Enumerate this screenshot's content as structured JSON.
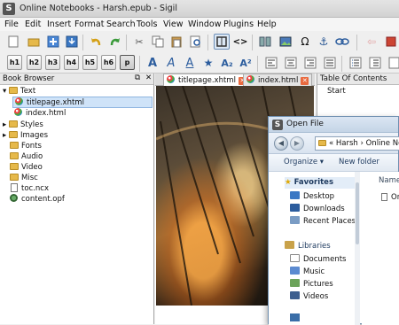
{
  "window": {
    "title": "Online Notebooks - Harsh.epub - Sigil"
  },
  "menu": [
    "File",
    "Edit",
    "Insert",
    "Format",
    "Search",
    "Tools",
    "View",
    "Window",
    "Plugins",
    "Help"
  ],
  "headings": [
    "h1",
    "h2",
    "h3",
    "h4",
    "h5",
    "h6",
    "p"
  ],
  "book_browser": {
    "title": "Book Browser",
    "items": [
      {
        "label": "Text",
        "type": "folder",
        "level": 0,
        "expanded": true
      },
      {
        "label": "titlepage.xhtml",
        "type": "html",
        "level": 1,
        "selected": true
      },
      {
        "label": "index.html",
        "type": "html",
        "level": 1
      },
      {
        "label": "Styles",
        "type": "folder",
        "level": 0
      },
      {
        "label": "Images",
        "type": "folder",
        "level": 0
      },
      {
        "label": "Fonts",
        "type": "folder",
        "level": 0
      },
      {
        "label": "Audio",
        "type": "folder",
        "level": 0
      },
      {
        "label": "Video",
        "type": "folder",
        "level": 0
      },
      {
        "label": "Misc",
        "type": "folder",
        "level": 0
      },
      {
        "label": "toc.ncx",
        "type": "file",
        "level": 0
      },
      {
        "label": "content.opf",
        "type": "file",
        "level": 0
      }
    ]
  },
  "tabs": [
    {
      "label": "titlepage.xhtml",
      "active": true
    },
    {
      "label": "index.html",
      "active": false
    }
  ],
  "toc": {
    "title": "Table Of Contents",
    "items": [
      "Start"
    ]
  },
  "dialog": {
    "title": "Open File",
    "breadcrumb": "« Harsh › Online Notebooks",
    "organize": "Organize ▾",
    "new_folder": "New folder",
    "column": "Name",
    "first_file": "Or",
    "nav": [
      {
        "label": "Favorites",
        "kind": "header",
        "icon": "star-icon"
      },
      {
        "label": "Desktop",
        "kind": "item",
        "icon": "desktop-icon"
      },
      {
        "label": "Downloads",
        "kind": "item",
        "icon": "downloads-icon"
      },
      {
        "label": "Recent Places",
        "kind": "item",
        "icon": "recent-places-icon"
      },
      {
        "label": "Libraries",
        "kind": "header",
        "icon": "libraries-icon"
      },
      {
        "label": "Documents",
        "kind": "item",
        "icon": "documents-icon"
      },
      {
        "label": "Music",
        "kind": "item",
        "icon": "music-icon"
      },
      {
        "label": "Pictures",
        "kind": "item",
        "icon": "pictures-icon"
      },
      {
        "label": "Videos",
        "kind": "item",
        "icon": "videos-icon"
      }
    ]
  },
  "colors": {
    "accent": "#2c5d9e",
    "tab_close": "#e96a3f",
    "folder": "#e6b94a"
  }
}
